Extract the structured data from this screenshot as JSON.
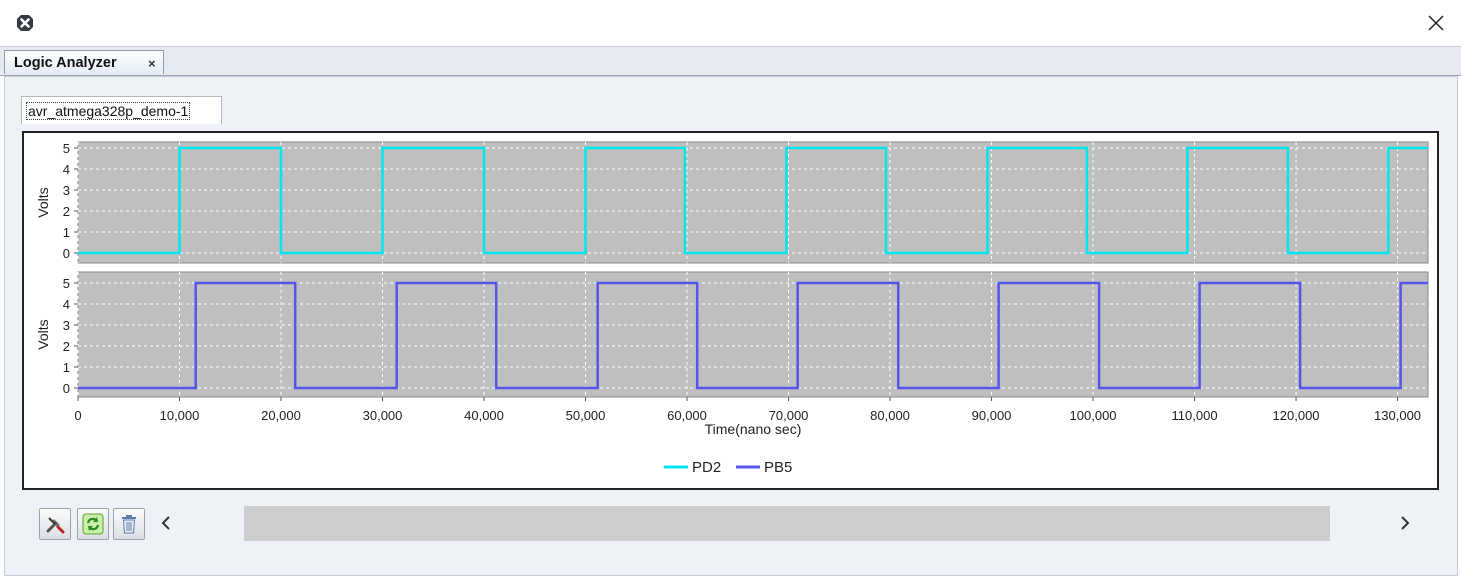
{
  "window": {
    "app_icon": "app-logo-icon",
    "close_icon": "close-icon"
  },
  "tabs": {
    "main_tab_label": "Logic Analyzer",
    "main_tab_close": "×",
    "device_tab_label": "avr_atmega328p_demo-1"
  },
  "toolbar": {
    "icons": [
      "tools-icon",
      "refresh-icon",
      "trash-icon"
    ]
  },
  "scrollbar": {
    "left_arrow": "‹",
    "right_arrow": "›"
  },
  "chart_data": {
    "type": "line",
    "subtype": "step",
    "xlabel": "Time(nano sec)",
    "x_ticks": [
      "0",
      "10,000",
      "20,000",
      "30,000",
      "40,000",
      "50,000",
      "60,000",
      "70,000",
      "80,000",
      "90,000",
      "100,000",
      "110,000",
      "120,000",
      "130,000"
    ],
    "xlim": [
      0,
      133000
    ],
    "legend_position": "bottom-center",
    "grid": true,
    "plot_background": "#bfbfbf",
    "panels": [
      {
        "ylabel": "Volts",
        "y_ticks": [
          "0",
          "1",
          "2",
          "3",
          "4",
          "5"
        ],
        "ylim": [
          0,
          5
        ],
        "series": {
          "name": "PD2",
          "color": "#00e5ee",
          "points": [
            [
              0,
              0
            ],
            [
              10000,
              0
            ],
            [
              10000,
              5
            ],
            [
              20000,
              5
            ],
            [
              20000,
              0
            ],
            [
              30000,
              0
            ],
            [
              30000,
              5
            ],
            [
              40000,
              5
            ],
            [
              40000,
              0
            ],
            [
              50000,
              0
            ],
            [
              50000,
              5
            ],
            [
              59800,
              5
            ],
            [
              59800,
              0
            ],
            [
              69800,
              0
            ],
            [
              69800,
              5
            ],
            [
              79600,
              5
            ],
            [
              79600,
              0
            ],
            [
              89600,
              0
            ],
            [
              89600,
              5
            ],
            [
              99400,
              5
            ],
            [
              99400,
              0
            ],
            [
              109300,
              0
            ],
            [
              109300,
              5
            ],
            [
              119200,
              5
            ],
            [
              119200,
              0
            ],
            [
              129100,
              0
            ],
            [
              129100,
              5
            ],
            [
              133000,
              5
            ]
          ]
        }
      },
      {
        "ylabel": "Volts",
        "y_ticks": [
          "0",
          "1",
          "2",
          "3",
          "4",
          "5"
        ],
        "ylim": [
          0,
          5
        ],
        "series": {
          "name": "PB5",
          "color": "#5555ee",
          "points": [
            [
              0,
              0
            ],
            [
              11600,
              0
            ],
            [
              11600,
              5
            ],
            [
              21400,
              5
            ],
            [
              21400,
              0
            ],
            [
              31400,
              0
            ],
            [
              31400,
              5
            ],
            [
              41200,
              5
            ],
            [
              41200,
              0
            ],
            [
              51200,
              0
            ],
            [
              51200,
              5
            ],
            [
              61000,
              5
            ],
            [
              61000,
              0
            ],
            [
              70900,
              0
            ],
            [
              70900,
              5
            ],
            [
              80800,
              5
            ],
            [
              80800,
              0
            ],
            [
              90700,
              0
            ],
            [
              90700,
              5
            ],
            [
              100600,
              5
            ],
            [
              100600,
              0
            ],
            [
              110500,
              0
            ],
            [
              110500,
              5
            ],
            [
              120400,
              5
            ],
            [
              120400,
              0
            ],
            [
              130300,
              0
            ],
            [
              130300,
              5
            ],
            [
              133000,
              5
            ]
          ]
        }
      }
    ]
  }
}
